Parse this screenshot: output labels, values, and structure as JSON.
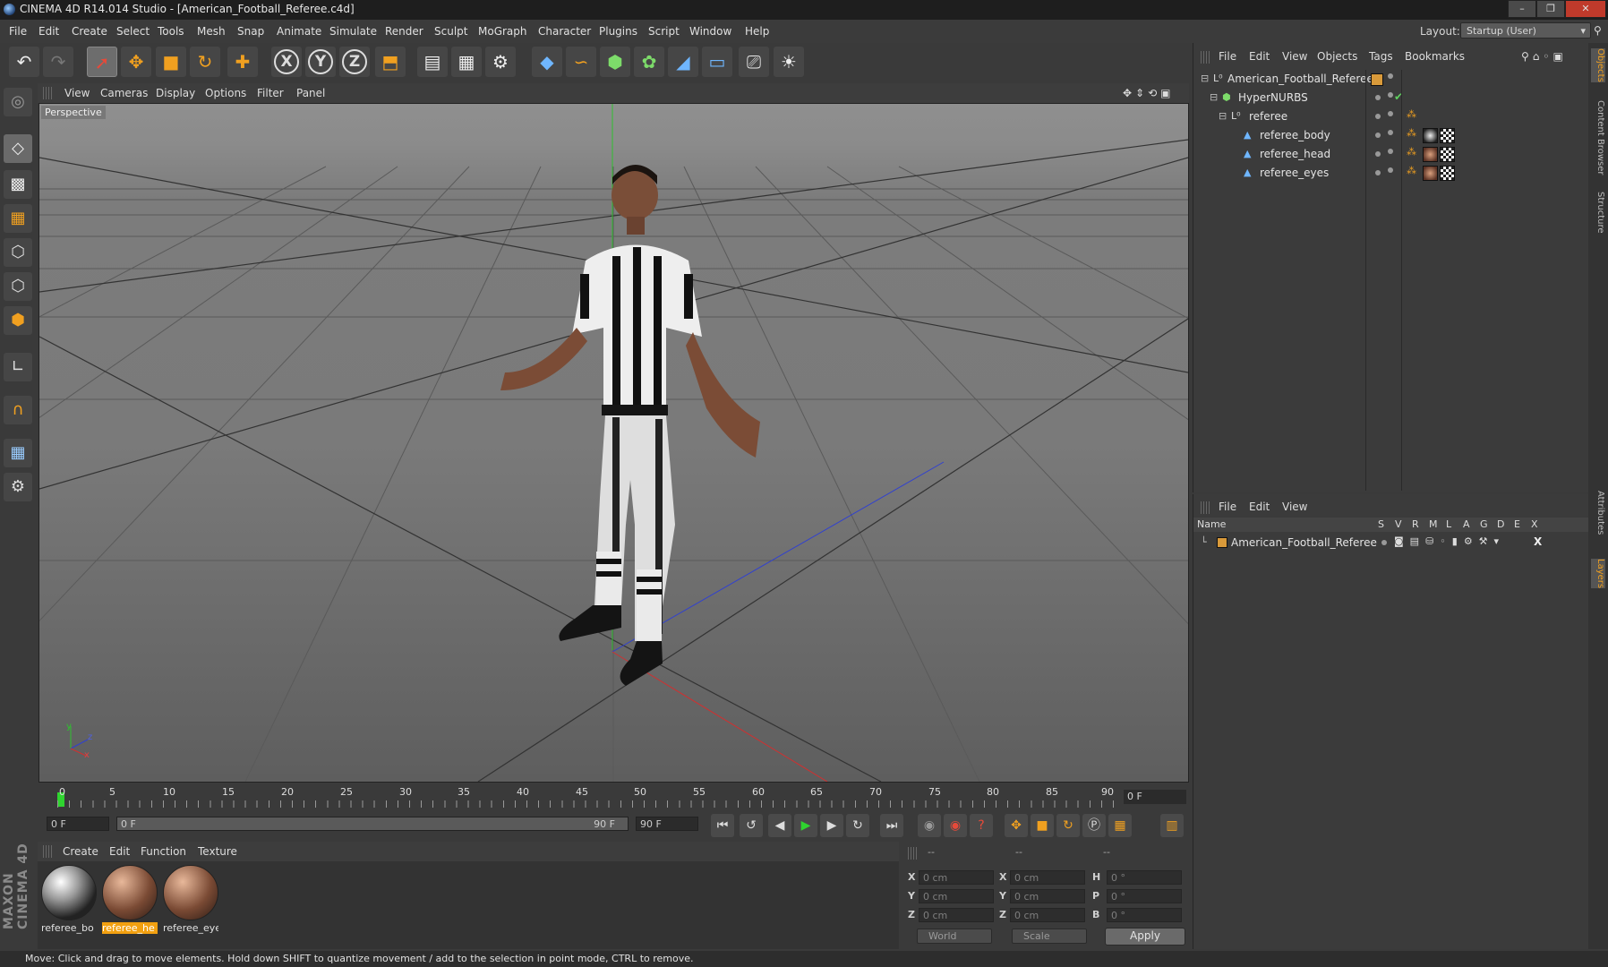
{
  "window": {
    "title": "CINEMA 4D R14.014 Studio - [American_Football_Referee.c4d]",
    "controls": [
      "–",
      "❐",
      "✕"
    ]
  },
  "menubar": {
    "items": [
      "File",
      "Edit",
      "Create",
      "Select",
      "Tools",
      "Mesh",
      "Snap",
      "Animate",
      "Simulate",
      "Render",
      "Sculpt",
      "MoGraph",
      "Character",
      "Plugins",
      "Script",
      "Window",
      "Help"
    ],
    "layout_label": "Layout:",
    "layout_value": "Startup (User)"
  },
  "toolbar": {
    "icons": [
      "undo-icon",
      "redo-icon",
      "live-selection-icon",
      "move-icon",
      "scale-icon",
      "rotate-icon",
      "last-tool-icon",
      "x-axis-icon",
      "y-axis-icon",
      "z-axis-icon",
      "coordinate-system-icon",
      "render-view-icon",
      "render-picture-viewer-icon",
      "edit-render-settings-icon",
      "cube-icon",
      "spline-pen-icon",
      "subdivision-surface-icon",
      "array-icon",
      "deformer-icon",
      "floor-icon",
      "camera-icon",
      "light-icon"
    ],
    "axis_labels": [
      "X",
      "Y",
      "Z"
    ]
  },
  "viewport": {
    "menu": [
      "View",
      "Cameras",
      "Display",
      "Options",
      "Filter",
      "Panel"
    ],
    "label": "Perspective",
    "axis_labels": [
      "y",
      "z",
      "x"
    ]
  },
  "timeline": {
    "ticks": [
      "0",
      "5",
      "10",
      "15",
      "20",
      "25",
      "30",
      "35",
      "40",
      "45",
      "50",
      "55",
      "60",
      "65",
      "70",
      "75",
      "80",
      "85",
      "90"
    ],
    "current_frame": "0 F",
    "start_field": "0 F",
    "range_start": "0 F",
    "range_end": "90 F",
    "end_field": "90 F"
  },
  "materials": {
    "menu": [
      "Create",
      "Edit",
      "Function",
      "Texture"
    ],
    "items": [
      {
        "label": "referee_bo",
        "selected": false,
        "kind": "body"
      },
      {
        "label": "referee_he",
        "selected": true,
        "kind": "skin"
      },
      {
        "label": "referee_eye",
        "selected": false,
        "kind": "skin"
      }
    ]
  },
  "coordinates": {
    "headers": [
      "--",
      "--",
      "--"
    ],
    "rows": [
      {
        "a": "X",
        "av": "0 cm",
        "b": "X",
        "bv": "0 cm",
        "c": "H",
        "cv": "0 °"
      },
      {
        "a": "Y",
        "av": "0 cm",
        "b": "Y",
        "bv": "0 cm",
        "c": "P",
        "cv": "0 °"
      },
      {
        "a": "Z",
        "av": "0 cm",
        "b": "Z",
        "bv": "0 cm",
        "c": "B",
        "cv": "0 °"
      }
    ],
    "mode": "World",
    "type": "Scale",
    "apply": "Apply"
  },
  "objects": {
    "menu": [
      "File",
      "Edit",
      "View",
      "Objects",
      "Tags",
      "Bookmarks"
    ],
    "tree": [
      {
        "name": "American_Football_Referee",
        "depth": 0,
        "icon": "null-icon"
      },
      {
        "name": "HyperNURBS",
        "depth": 1,
        "icon": "hypernurbs-icon"
      },
      {
        "name": "referee",
        "depth": 2,
        "icon": "null-icon"
      },
      {
        "name": "referee_body",
        "depth": 3,
        "icon": "polygon-icon"
      },
      {
        "name": "referee_head",
        "depth": 3,
        "icon": "polygon-icon"
      },
      {
        "name": "referee_eyes",
        "depth": 3,
        "icon": "polygon-icon"
      }
    ]
  },
  "layers": {
    "menu": [
      "File",
      "Edit",
      "View"
    ],
    "columns": [
      "Name",
      "S",
      "V",
      "R",
      "M",
      "L",
      "A",
      "G",
      "D",
      "E",
      "X"
    ],
    "rows": [
      {
        "name": "American_Football_Referee"
      }
    ]
  },
  "right_tabs": [
    "Objects",
    "Content Browser",
    "Structure",
    "Attributes",
    "Layers"
  ],
  "branding": "MAXON CINEMA 4D",
  "status": "Move: Click and drag to move elements. Hold down SHIFT to quantize movement / add to the selection in point mode, CTRL to remove.",
  "colors": {
    "accent": "#f2a010",
    "timeline_marker": "#2fd42f",
    "axis_x": "#d03030",
    "axis_y": "#30c030",
    "axis_z": "#3040d0"
  }
}
